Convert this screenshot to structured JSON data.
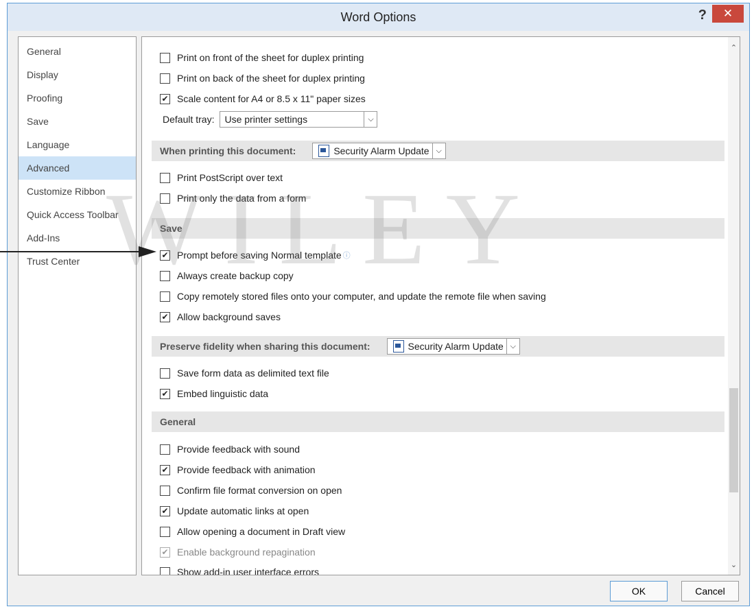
{
  "window": {
    "title": "Word Options",
    "help_label": "?",
    "close_label": "✕"
  },
  "sidebar": {
    "items": [
      {
        "label": "General"
      },
      {
        "label": "Display"
      },
      {
        "label": "Proofing"
      },
      {
        "label": "Save"
      },
      {
        "label": "Language"
      },
      {
        "label": "Advanced"
      },
      {
        "label": "Customize Ribbon"
      },
      {
        "label": "Quick Access Toolbar"
      },
      {
        "label": "Add-Ins"
      },
      {
        "label": "Trust Center"
      }
    ],
    "active": "Advanced"
  },
  "print": {
    "front_duplex": "Print on front of the sheet for duplex printing",
    "back_duplex": "Print on back of the sheet for duplex printing",
    "scale_content": "Scale content for A4 or 8.5 x 11\" paper sizes",
    "default_tray_label": "Default tray:",
    "default_tray_value": "Use printer settings"
  },
  "when_printing": {
    "header": "When printing this document:",
    "doc": "Security Alarm Update",
    "postscript": "Print PostScript over text",
    "form_data_only": "Print only the data from a form"
  },
  "save": {
    "header": "Save",
    "prompt_normal": "Prompt before saving Normal template",
    "backup_copy": "Always create backup copy",
    "copy_remote": "Copy remotely stored files onto your computer, and update the remote file when saving",
    "background_saves": "Allow background saves"
  },
  "preserve": {
    "header": "Preserve fidelity when sharing this document:",
    "doc": "Security Alarm Update",
    "form_delimited": "Save form data as delimited text file",
    "embed_linguistic": "Embed linguistic data"
  },
  "general": {
    "header": "General",
    "feedback_sound": "Provide feedback with sound",
    "feedback_animation": "Provide feedback with animation",
    "confirm_conversion": "Confirm file format conversion on open",
    "update_links": "Update automatic links at open",
    "draft_view": "Allow opening a document in Draft view",
    "background_repagination": "Enable background repagination",
    "addin_errors": "Show add-in user interface errors"
  },
  "buttons": {
    "ok": "OK",
    "cancel": "Cancel"
  },
  "watermark": "WILEY",
  "check": "✔",
  "colors": {
    "accent": "#5b9bd5",
    "active_nav": "#cde3f7",
    "close": "#c9483c"
  }
}
